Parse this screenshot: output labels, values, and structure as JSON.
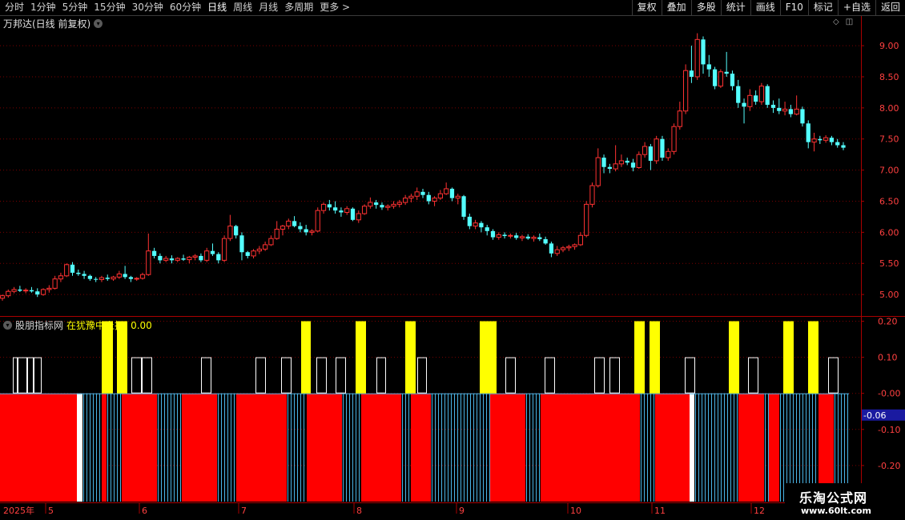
{
  "toolbar": {
    "periods": [
      "分时",
      "1分钟",
      "5分钟",
      "15分钟",
      "30分钟",
      "60分钟",
      "日线",
      "周线",
      "月线",
      "多周期",
      "更多 >"
    ],
    "active_period": "日线",
    "actions": [
      "复权",
      "叠加",
      "多股",
      "统计",
      "画线",
      "F10",
      "标记",
      "+自选",
      "返回"
    ]
  },
  "main_panel": {
    "title": "万邦达(日线 前复权)",
    "tool_icons": [
      "diamond-icon",
      "square-icon"
    ]
  },
  "indicator_panel": {
    "name": "股朋指标网",
    "formula_label": "在犹豫中上扬:",
    "formula_value": "0.00",
    "current_value": "-0.06"
  },
  "watermark": {
    "text": "乐淘公式网",
    "url": "www.60lt.com"
  },
  "colors": {
    "up": "#ff3232",
    "down": "#54ffff",
    "yellow": "#ffff00",
    "red_bar": "#ff0000",
    "grid": "#7a0000",
    "axis": "#aa0000"
  },
  "chart_data": [
    {
      "type": "candlestick",
      "title": "万邦达(日线 前复权)",
      "y_ticks": [
        "9.00",
        "8.50",
        "8.00",
        "7.50",
        "7.00",
        "6.50",
        "6.00",
        "5.50",
        "5.00"
      ],
      "ylim": [
        4.68,
        9.22
      ],
      "x_ticks": [
        "2025年",
        "5",
        "6",
        "7",
        "8",
        "9",
        "10",
        "11",
        "12"
      ],
      "ohlc": [
        [
          4.94,
          5.0,
          4.9,
          4.98
        ],
        [
          4.98,
          5.08,
          4.95,
          5.05
        ],
        [
          5.05,
          5.12,
          5.02,
          5.08
        ],
        [
          5.08,
          5.14,
          5.04,
          5.06
        ],
        [
          5.06,
          5.1,
          5.02,
          5.07
        ],
        [
          5.07,
          5.12,
          5.03,
          5.05
        ],
        [
          5.05,
          5.1,
          4.96,
          5.0
        ],
        [
          5.0,
          5.1,
          4.98,
          5.08
        ],
        [
          5.08,
          5.15,
          5.03,
          5.1
        ],
        [
          5.1,
          5.3,
          5.08,
          5.25
        ],
        [
          5.25,
          5.35,
          5.2,
          5.3
        ],
        [
          5.3,
          5.5,
          5.28,
          5.48
        ],
        [
          5.48,
          5.52,
          5.3,
          5.35
        ],
        [
          5.35,
          5.4,
          5.3,
          5.33
        ],
        [
          5.33,
          5.38,
          5.25,
          5.3
        ],
        [
          5.3,
          5.32,
          5.22,
          5.25
        ],
        [
          5.25,
          5.28,
          5.2,
          5.24
        ],
        [
          5.24,
          5.3,
          5.2,
          5.27
        ],
        [
          5.27,
          5.32,
          5.22,
          5.25
        ],
        [
          5.25,
          5.3,
          5.22,
          5.28
        ],
        [
          5.28,
          5.38,
          5.25,
          5.33
        ],
        [
          5.33,
          5.46,
          5.25,
          5.28
        ],
        [
          5.28,
          5.3,
          5.2,
          5.25
        ],
        [
          5.25,
          5.28,
          5.22,
          5.26
        ],
        [
          5.26,
          5.35,
          5.24,
          5.32
        ],
        [
          5.32,
          5.98,
          5.3,
          5.7
        ],
        [
          5.7,
          5.75,
          5.58,
          5.62
        ],
        [
          5.62,
          5.66,
          5.5,
          5.55
        ],
        [
          5.55,
          5.62,
          5.52,
          5.58
        ],
        [
          5.58,
          5.63,
          5.5,
          5.55
        ],
        [
          5.55,
          5.6,
          5.52,
          5.58
        ],
        [
          5.58,
          5.64,
          5.54,
          5.56
        ],
        [
          5.56,
          5.62,
          5.5,
          5.6
        ],
        [
          5.6,
          5.65,
          5.55,
          5.62
        ],
        [
          5.62,
          5.66,
          5.52,
          5.55
        ],
        [
          5.55,
          5.75,
          5.52,
          5.7
        ],
        [
          5.7,
          5.82,
          5.62,
          5.65
        ],
        [
          5.65,
          5.68,
          5.5,
          5.55
        ],
        [
          5.55,
          5.95,
          5.52,
          5.9
        ],
        [
          5.9,
          6.28,
          5.86,
          6.1
        ],
        [
          6.1,
          6.12,
          5.9,
          5.95
        ],
        [
          5.95,
          6.0,
          5.55,
          5.68
        ],
        [
          5.68,
          5.7,
          5.58,
          5.62
        ],
        [
          5.62,
          5.73,
          5.58,
          5.7
        ],
        [
          5.7,
          5.78,
          5.65,
          5.73
        ],
        [
          5.73,
          5.85,
          5.7,
          5.8
        ],
        [
          5.8,
          5.95,
          5.78,
          5.9
        ],
        [
          5.9,
          6.18,
          5.88,
          6.05
        ],
        [
          6.05,
          6.12,
          5.95,
          6.1
        ],
        [
          6.1,
          6.22,
          6.05,
          6.18
        ],
        [
          6.18,
          6.26,
          6.08,
          6.1
        ],
        [
          6.1,
          6.16,
          6.0,
          6.05
        ],
        [
          6.05,
          6.12,
          5.95,
          6.0
        ],
        [
          6.0,
          6.05,
          5.95,
          6.02
        ],
        [
          6.02,
          6.4,
          6.0,
          6.35
        ],
        [
          6.35,
          6.48,
          6.3,
          6.45
        ],
        [
          6.45,
          6.52,
          6.35,
          6.4
        ],
        [
          6.4,
          6.5,
          6.3,
          6.35
        ],
        [
          6.35,
          6.4,
          6.25,
          6.32
        ],
        [
          6.32,
          6.42,
          6.28,
          6.38
        ],
        [
          6.38,
          6.4,
          6.18,
          6.2
        ],
        [
          6.2,
          6.35,
          6.15,
          6.3
        ],
        [
          6.3,
          6.45,
          6.28,
          6.42
        ],
        [
          6.42,
          6.56,
          6.38,
          6.48
        ],
        [
          6.48,
          6.52,
          6.38,
          6.44
        ],
        [
          6.44,
          6.48,
          6.36,
          6.4
        ],
        [
          6.4,
          6.45,
          6.35,
          6.42
        ],
        [
          6.42,
          6.5,
          6.38,
          6.45
        ],
        [
          6.45,
          6.52,
          6.4,
          6.48
        ],
        [
          6.48,
          6.6,
          6.44,
          6.55
        ],
        [
          6.55,
          6.62,
          6.48,
          6.58
        ],
        [
          6.58,
          6.72,
          6.52,
          6.65
        ],
        [
          6.65,
          6.7,
          6.55,
          6.6
        ],
        [
          6.6,
          6.65,
          6.45,
          6.5
        ],
        [
          6.5,
          6.58,
          6.42,
          6.55
        ],
        [
          6.55,
          6.68,
          6.52,
          6.62
        ],
        [
          6.62,
          6.8,
          6.6,
          6.7
        ],
        [
          6.7,
          6.72,
          6.5,
          6.55
        ],
        [
          6.55,
          6.62,
          6.45,
          6.58
        ],
        [
          6.58,
          6.6,
          6.2,
          6.25
        ],
        [
          6.25,
          6.3,
          6.05,
          6.1
        ],
        [
          6.1,
          6.2,
          6.05,
          6.15
        ],
        [
          6.15,
          6.18,
          6.0,
          6.08
        ],
        [
          6.08,
          6.12,
          5.95,
          6.02
        ],
        [
          6.02,
          6.05,
          5.88,
          5.92
        ],
        [
          5.92,
          6.0,
          5.88,
          5.96
        ],
        [
          5.96,
          6.0,
          5.9,
          5.94
        ],
        [
          5.94,
          5.98,
          5.9,
          5.95
        ],
        [
          5.95,
          5.99,
          5.88,
          5.91
        ],
        [
          5.91,
          5.96,
          5.86,
          5.93
        ],
        [
          5.93,
          5.97,
          5.88,
          5.9
        ],
        [
          5.9,
          5.95,
          5.85,
          5.92
        ],
        [
          5.92,
          5.98,
          5.86,
          5.89
        ],
        [
          5.89,
          5.93,
          5.8,
          5.82
        ],
        [
          5.82,
          5.85,
          5.6,
          5.66
        ],
        [
          5.66,
          5.78,
          5.62,
          5.72
        ],
        [
          5.72,
          5.78,
          5.68,
          5.75
        ],
        [
          5.75,
          5.8,
          5.7,
          5.77
        ],
        [
          5.77,
          5.82,
          5.72,
          5.8
        ],
        [
          5.8,
          6.0,
          5.78,
          5.95
        ],
        [
          5.95,
          6.5,
          5.92,
          6.45
        ],
        [
          6.45,
          6.8,
          6.4,
          6.75
        ],
        [
          6.75,
          7.35,
          6.72,
          7.2
        ],
        [
          7.2,
          7.25,
          6.95,
          7.05
        ],
        [
          7.05,
          7.1,
          6.95,
          7.02
        ],
        [
          7.02,
          7.4,
          6.98,
          7.1
        ],
        [
          7.1,
          7.25,
          7.05,
          7.15
        ],
        [
          7.15,
          7.2,
          7.08,
          7.12
        ],
        [
          7.12,
          7.18,
          6.98,
          7.04
        ],
        [
          7.04,
          7.3,
          7.02,
          7.25
        ],
        [
          7.25,
          7.45,
          7.2,
          7.38
        ],
        [
          7.38,
          7.42,
          7.0,
          7.15
        ],
        [
          7.15,
          7.55,
          7.1,
          7.5
        ],
        [
          7.5,
          7.55,
          7.15,
          7.2
        ],
        [
          7.2,
          7.35,
          7.15,
          7.3
        ],
        [
          7.3,
          7.75,
          7.25,
          7.7
        ],
        [
          7.7,
          8.1,
          7.65,
          7.95
        ],
        [
          7.95,
          8.7,
          7.9,
          8.6
        ],
        [
          8.6,
          9.0,
          8.4,
          8.5
        ],
        [
          8.5,
          9.2,
          8.45,
          9.1
        ],
        [
          9.1,
          9.15,
          8.55,
          8.7
        ],
        [
          8.7,
          8.85,
          8.5,
          8.62
        ],
        [
          8.62,
          8.66,
          8.3,
          8.35
        ],
        [
          8.35,
          8.62,
          8.32,
          8.58
        ],
        [
          8.58,
          8.9,
          8.5,
          8.55
        ],
        [
          8.55,
          8.6,
          8.28,
          8.35
        ],
        [
          8.35,
          8.45,
          8.0,
          8.08
        ],
        [
          8.08,
          8.15,
          7.75,
          8.02
        ],
        [
          8.02,
          8.3,
          7.95,
          8.2
        ],
        [
          8.2,
          8.28,
          8.05,
          8.1
        ],
        [
          8.1,
          8.4,
          8.05,
          8.35
        ],
        [
          8.35,
          8.38,
          8.0,
          8.05
        ],
        [
          8.05,
          8.12,
          7.92,
          8.0
        ],
        [
          8.0,
          8.15,
          7.9,
          7.95
        ],
        [
          7.95,
          8.1,
          7.88,
          7.98
        ],
        [
          7.98,
          8.05,
          7.85,
          7.9
        ],
        [
          7.9,
          8.2,
          7.88,
          7.98
        ],
        [
          7.98,
          8.02,
          7.7,
          7.75
        ],
        [
          7.75,
          7.8,
          7.35,
          7.45
        ],
        [
          7.45,
          7.6,
          7.3,
          7.5
        ],
        [
          7.5,
          7.55,
          7.42,
          7.48
        ],
        [
          7.48,
          7.56,
          7.44,
          7.52
        ],
        [
          7.52,
          7.55,
          7.4,
          7.45
        ],
        [
          7.45,
          7.5,
          7.36,
          7.4
        ],
        [
          7.4,
          7.45,
          7.32,
          7.36
        ]
      ]
    },
    {
      "type": "bar",
      "title": "股朋指标网",
      "y_ticks": [
        "0.20",
        "0.10",
        "-0.00",
        "-0.10",
        "-0.20"
      ],
      "ylim": [
        -0.3,
        0.21
      ],
      "current_value": -0.06,
      "white_box_height": 0.1,
      "yellow_height": 0.2,
      "red_bottom": -0.3,
      "positive_bars": [
        {
          "kind": "white",
          "from": 16,
          "to": 22
        },
        {
          "kind": "white",
          "from": 22,
          "to": 34
        },
        {
          "kind": "white",
          "from": 34,
          "to": 42
        },
        {
          "kind": "white",
          "from": 42,
          "to": 52
        },
        {
          "kind": "yellow",
          "from": 127,
          "to": 141
        },
        {
          "kind": "yellow",
          "from": 146,
          "to": 159
        },
        {
          "kind": "white",
          "from": 164,
          "to": 177
        },
        {
          "kind": "white",
          "from": 177,
          "to": 190
        },
        {
          "kind": "white",
          "from": 251,
          "to": 264
        },
        {
          "kind": "white",
          "from": 319,
          "to": 332
        },
        {
          "kind": "white",
          "from": 351,
          "to": 364
        },
        {
          "kind": "yellow",
          "from": 376,
          "to": 388
        },
        {
          "kind": "white",
          "from": 395,
          "to": 408
        },
        {
          "kind": "white",
          "from": 419,
          "to": 432
        },
        {
          "kind": "yellow",
          "from": 444,
          "to": 457
        },
        {
          "kind": "white",
          "from": 470,
          "to": 482
        },
        {
          "kind": "yellow",
          "from": 506,
          "to": 519
        },
        {
          "kind": "white",
          "from": 521,
          "to": 533
        },
        {
          "kind": "yellow",
          "from": 599,
          "to": 620
        },
        {
          "kind": "white",
          "from": 631,
          "to": 644
        },
        {
          "kind": "white",
          "from": 680,
          "to": 693
        },
        {
          "kind": "white",
          "from": 742,
          "to": 755
        },
        {
          "kind": "white",
          "from": 761,
          "to": 774
        },
        {
          "kind": "yellow",
          "from": 792,
          "to": 805
        },
        {
          "kind": "yellow",
          "from": 811,
          "to": 824
        },
        {
          "kind": "white",
          "from": 855,
          "to": 868
        },
        {
          "kind": "yellow",
          "from": 910,
          "to": 923
        },
        {
          "kind": "white",
          "from": 934,
          "to": 947
        },
        {
          "kind": "yellow",
          "from": 978,
          "to": 991
        },
        {
          "kind": "yellow",
          "from": 1009,
          "to": 1022
        },
        {
          "kind": "white",
          "from": 1034,
          "to": 1047
        }
      ],
      "negative_segments": [
        {
          "kind": "red",
          "from": 0,
          "to": 96
        },
        {
          "kind": "white",
          "from": 96,
          "to": 103
        },
        {
          "kind": "lines",
          "from": 103,
          "to": 127
        },
        {
          "kind": "red",
          "from": 127,
          "to": 133
        },
        {
          "kind": "lines",
          "from": 133,
          "to": 152
        },
        {
          "kind": "red",
          "from": 152,
          "to": 196
        },
        {
          "kind": "lines",
          "from": 196,
          "to": 227
        },
        {
          "kind": "red",
          "from": 227,
          "to": 271
        },
        {
          "kind": "lines",
          "from": 271,
          "to": 295
        },
        {
          "kind": "red",
          "from": 295,
          "to": 358
        },
        {
          "kind": "lines",
          "from": 358,
          "to": 383
        },
        {
          "kind": "red",
          "from": 383,
          "to": 427
        },
        {
          "kind": "lines",
          "from": 427,
          "to": 451
        },
        {
          "kind": "red",
          "from": 451,
          "to": 501
        },
        {
          "kind": "lines",
          "from": 501,
          "to": 513
        },
        {
          "kind": "red",
          "from": 513,
          "to": 538
        },
        {
          "kind": "lines",
          "from": 538,
          "to": 612
        },
        {
          "kind": "red",
          "from": 612,
          "to": 656
        },
        {
          "kind": "lines",
          "from": 656,
          "to": 675
        },
        {
          "kind": "red",
          "from": 675,
          "to": 799
        },
        {
          "kind": "lines",
          "from": 799,
          "to": 818
        },
        {
          "kind": "red",
          "from": 818,
          "to": 861
        },
        {
          "kind": "white",
          "from": 861,
          "to": 867
        },
        {
          "kind": "lines",
          "from": 867,
          "to": 922
        },
        {
          "kind": "red",
          "from": 922,
          "to": 954
        },
        {
          "kind": "lines",
          "from": 954,
          "to": 960
        },
        {
          "kind": "red",
          "from": 960,
          "to": 973
        },
        {
          "kind": "lines",
          "from": 973,
          "to": 1022
        },
        {
          "kind": "red",
          "from": 1022,
          "to": 1041
        },
        {
          "kind": "lines",
          "from": 1041,
          "to": 1060
        }
      ]
    }
  ]
}
